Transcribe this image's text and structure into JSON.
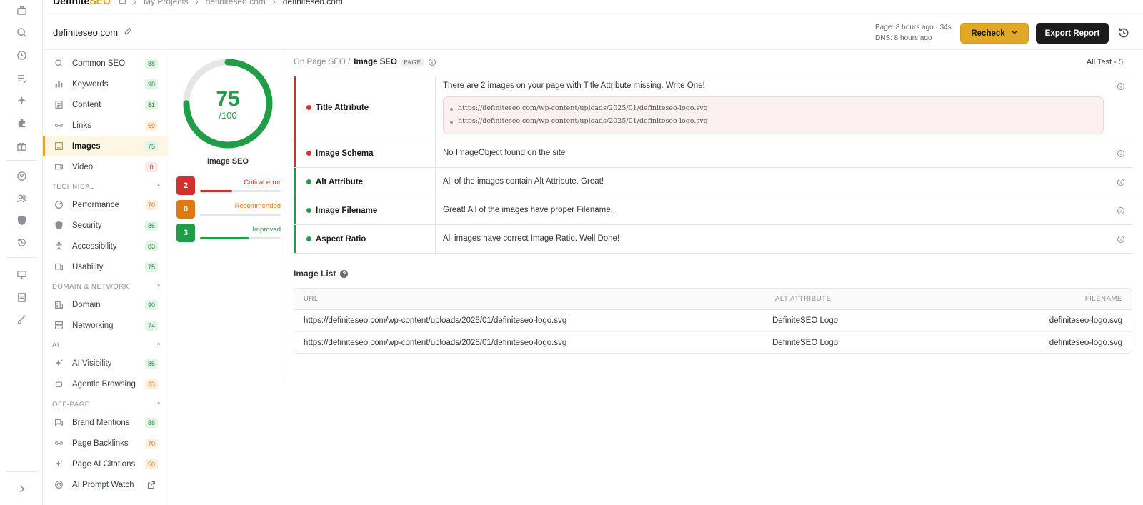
{
  "brand": {
    "name_a": "Definite",
    "name_b": "SEO"
  },
  "breadcrumbs": {
    "projects": "My Projects",
    "site1": "definiteseo.com",
    "site2": "definiteseo.com"
  },
  "header": {
    "site_name": "definiteseo.com",
    "page_meta": "Page: 8 hours ago · 34s",
    "dns_meta": "DNS: 8 hours ago",
    "recheck_label": "Recheck",
    "export_label": "Export Report"
  },
  "sidebar": {
    "items": [
      {
        "label": "Common SEO",
        "badge": "88"
      },
      {
        "label": "Keywords",
        "badge": "98"
      },
      {
        "label": "Content",
        "badge": "81"
      },
      {
        "label": "Links",
        "badge": "69"
      },
      {
        "label": "Images",
        "badge": "75"
      },
      {
        "label": "Video",
        "badge": "0"
      },
      {
        "label": "Performance",
        "badge": "70"
      },
      {
        "label": "Security",
        "badge": "86"
      },
      {
        "label": "Accessibility",
        "badge": "83"
      },
      {
        "label": "Usability",
        "badge": "75"
      },
      {
        "label": "Domain",
        "badge": "90"
      },
      {
        "label": "Networking",
        "badge": "74"
      },
      {
        "label": "AI Visibility",
        "badge": "85"
      },
      {
        "label": "Agentic Browsing",
        "badge": "33"
      },
      {
        "label": "Brand Mentions",
        "badge": "88"
      },
      {
        "label": "Page Backlinks",
        "badge": "70"
      },
      {
        "label": "Page AI Citations",
        "badge": "50"
      },
      {
        "label": "AI Prompt Watch",
        "badge": ""
      }
    ],
    "sections": {
      "technical": "TECHNICAL",
      "domain_network": "DOMAIN & NETWORK",
      "ai": "AI",
      "off_page": "OFF-PAGE"
    }
  },
  "score": {
    "value": "75",
    "max": "/100",
    "fraction": 0.75,
    "label": "Image SEO",
    "critical": {
      "count": "2",
      "label": "Critical error",
      "fraction": 0.4
    },
    "recommended": {
      "count": "0",
      "label": "Recommended",
      "fraction": 0
    },
    "improved": {
      "count": "3",
      "label": "Improved",
      "fraction": 0.6
    }
  },
  "main": {
    "crumb_parent": "On Page SEO /",
    "crumb_current": "Image SEO",
    "crumb_tag": "PAGE",
    "all_test": "All Test - 5",
    "tests": [
      {
        "name": "Title Attribute",
        "message": "There are 2 images on your page with Title Attribute missing. Write One!",
        "status": "error",
        "urls": [
          "https://definiteseo.com/wp-content/uploads/2025/01/definiteseo-logo.svg",
          "https://definiteseo.com/wp-content/uploads/2025/01/definiteseo-logo.svg"
        ]
      },
      {
        "name": "Image Schema",
        "message": "No ImageObject found on the site",
        "status": "error"
      },
      {
        "name": "Alt Attribute",
        "message": "All of the images contain Alt Attribute. Great!",
        "status": "pass"
      },
      {
        "name": "Image Filename",
        "message": "Great! All of the images have proper Filename.",
        "status": "pass"
      },
      {
        "name": "Aspect Ratio",
        "message": "All images have correct Image Ratio. Well Done!",
        "status": "pass"
      }
    ],
    "image_list": {
      "title": "Image List",
      "headers": {
        "url": "URL",
        "alt": "ALT ATTRIBUTE",
        "filename": "FILENAME"
      },
      "rows": [
        {
          "url": "https://definiteseo.com/wp-content/uploads/2025/01/definiteseo-logo.svg",
          "alt": "DefiniteSEO Logo",
          "filename": "definiteseo-logo.svg"
        },
        {
          "url": "https://definiteseo.com/wp-content/uploads/2025/01/definiteseo-logo.svg",
          "alt": "DefiniteSEO Logo",
          "filename": "definiteseo-logo.svg"
        }
      ]
    }
  },
  "colors": {
    "accent": "#e0a826",
    "error": "#d32f2f",
    "pass": "#1f9d47",
    "warn": "#d4730f"
  }
}
